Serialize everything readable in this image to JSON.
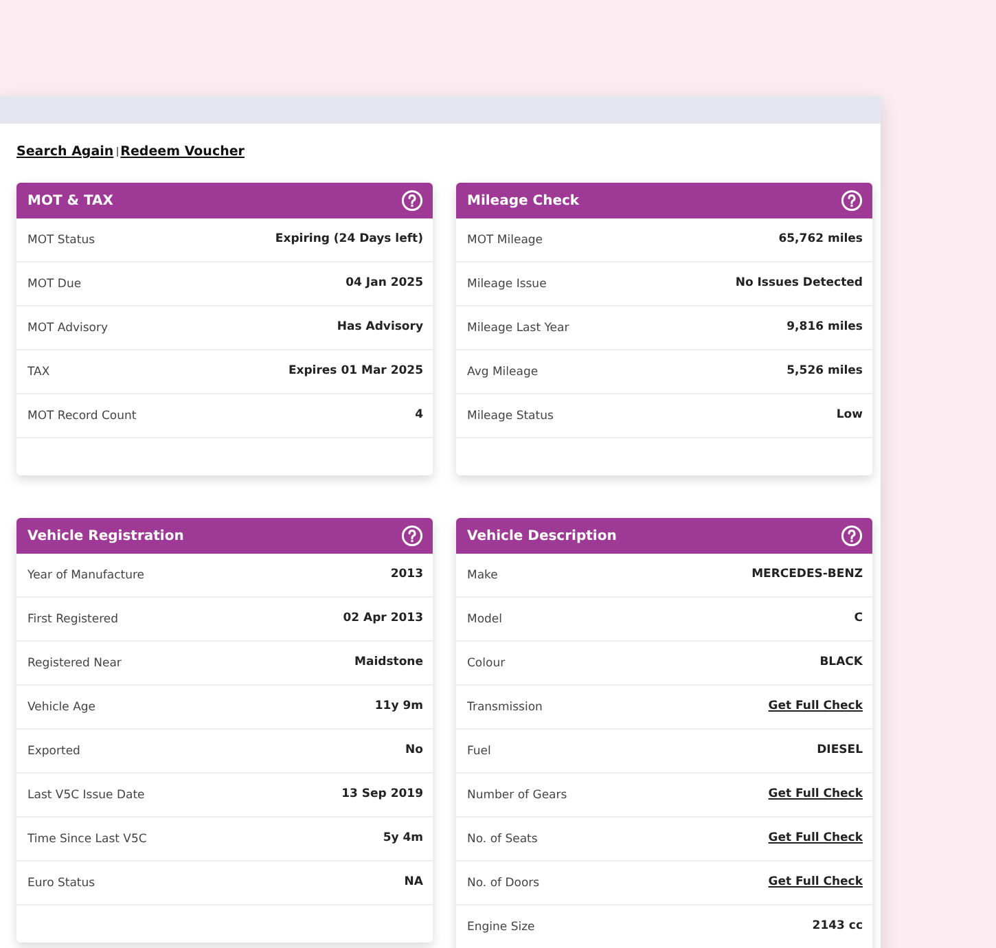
{
  "links": [
    {
      "label": "Search Again"
    },
    {
      "label": "Redeem Voucher"
    }
  ],
  "cards": [
    {
      "title": "MOT & TAX",
      "rows": [
        {
          "label": "MOT Status",
          "value": "Expiring (24 Days left)",
          "kind": "text"
        },
        {
          "label": "MOT Due",
          "value": "04 Jan 2025",
          "kind": "text"
        },
        {
          "label": "MOT Advisory",
          "value": "Has Advisory",
          "kind": "text"
        },
        {
          "label": "TAX",
          "value": "Expires 01 Mar 2025",
          "kind": "text"
        },
        {
          "label": "MOT Record Count",
          "value": "4",
          "kind": "text"
        }
      ]
    },
    {
      "title": "Mileage Check",
      "rows": [
        {
          "label": "MOT Mileage",
          "value": "65,762 miles",
          "kind": "text"
        },
        {
          "label": "Mileage Issue",
          "value": "No Issues Detected",
          "kind": "text"
        },
        {
          "label": "Mileage Last Year",
          "value": "9,816 miles",
          "kind": "text"
        },
        {
          "label": "Avg Mileage",
          "value": "5,526 miles",
          "kind": "text"
        },
        {
          "label": "Mileage Status",
          "value": "Low",
          "kind": "text"
        }
      ]
    },
    {
      "title": "Vehicle Registration",
      "rows": [
        {
          "label": "Year of Manufacture",
          "value": "2013",
          "kind": "text"
        },
        {
          "label": "First Registered",
          "value": "02 Apr 2013",
          "kind": "text"
        },
        {
          "label": "Registered Near",
          "value": "Maidstone",
          "kind": "text"
        },
        {
          "label": "Vehicle Age",
          "value": "11y 9m",
          "kind": "text"
        },
        {
          "label": "Exported",
          "value": "No",
          "kind": "text"
        },
        {
          "label": "Last V5C Issue Date",
          "value": "13 Sep 2019",
          "kind": "text"
        },
        {
          "label": "Time Since Last V5C",
          "value": "5y 4m",
          "kind": "text"
        },
        {
          "label": "Euro Status",
          "value": "NA",
          "kind": "text"
        }
      ]
    },
    {
      "title": "Vehicle Description",
      "rows": [
        {
          "label": "Make",
          "value": "MERCEDES-BENZ",
          "kind": "text"
        },
        {
          "label": "Model",
          "value": "C",
          "kind": "text"
        },
        {
          "label": "Colour",
          "value": "BLACK",
          "kind": "text"
        },
        {
          "label": "Transmission",
          "value": "Get Full Check",
          "kind": "link"
        },
        {
          "label": "Fuel",
          "value": "DIESEL",
          "kind": "text"
        },
        {
          "label": "Number of Gears",
          "value": "Get Full Check",
          "kind": "link"
        },
        {
          "label": "No. of Seats",
          "value": "Get Full Check",
          "kind": "link"
        },
        {
          "label": "No. of Doors",
          "value": "Get Full Check",
          "kind": "link"
        },
        {
          "label": "Engine Size",
          "value": "2143 cc",
          "kind": "text"
        }
      ]
    }
  ]
}
